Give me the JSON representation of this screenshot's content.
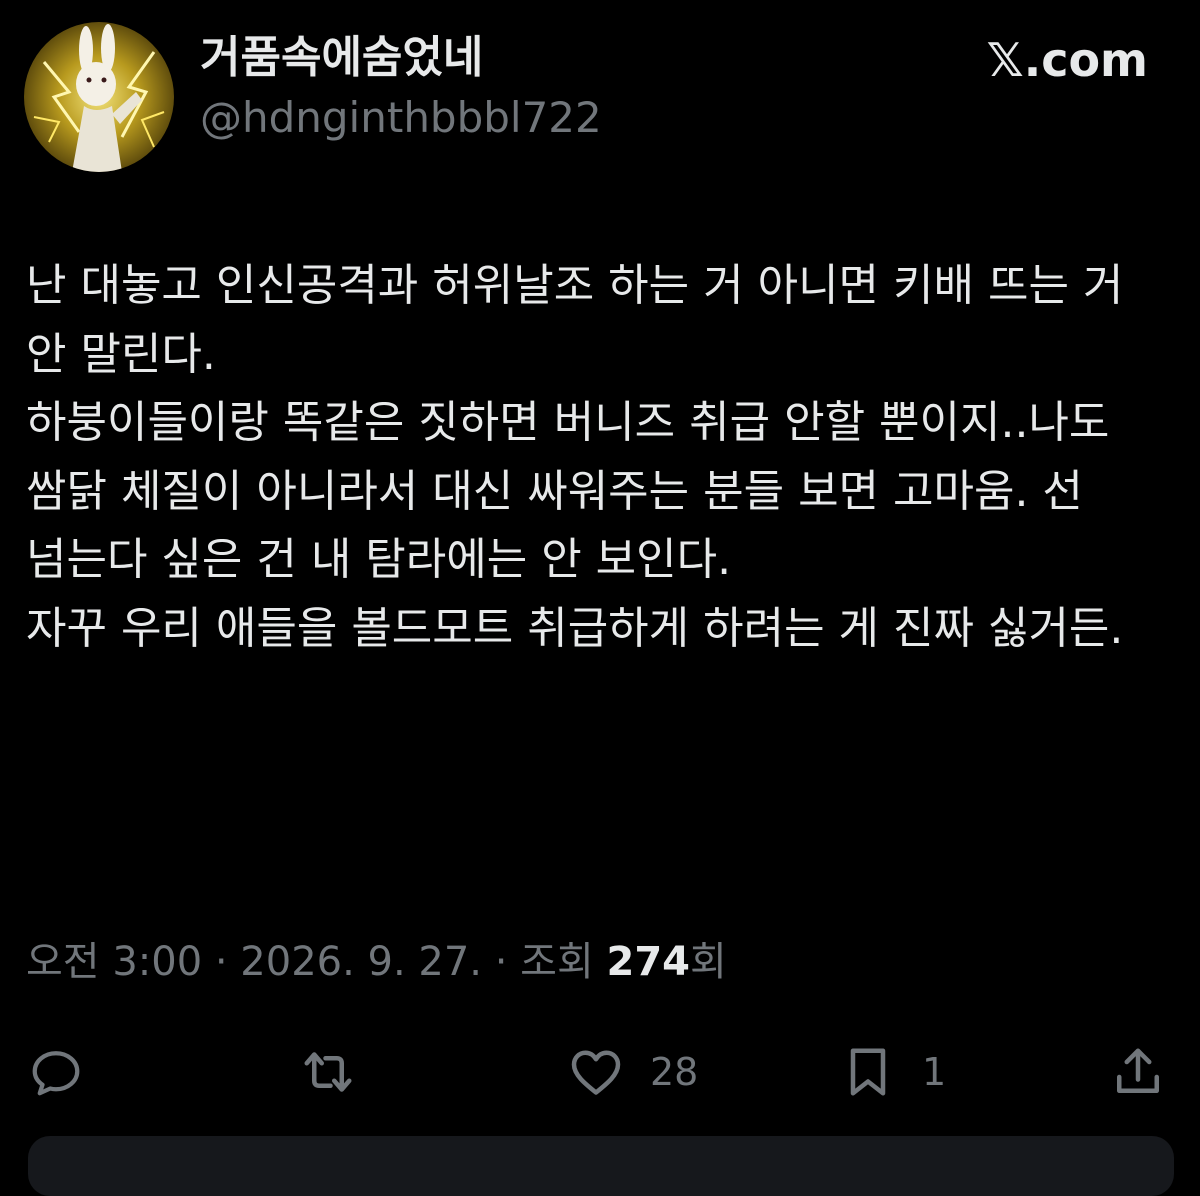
{
  "profile": {
    "display_name": "거품속에숨었네",
    "handle": "@hdnginthbbbl722",
    "avatar": "white-rabbit-lightning-avatar"
  },
  "brand": {
    "label": "𝕏.com"
  },
  "tweet": {
    "paragraphs": [
      "난 대놓고 인신공격과 허위날조 하는 거 아니면 키배 뜨는 거 안 말린다.",
      "하붕이들이랑 똑같은 짓하면 버니즈 취급 안할 뿐이지..나도 쌈닭 체질이 아니라서 대신 싸워주는 분들 보면 고마움. 선 넘는다 싶은 건 내 탐라에는 안 보인다.",
      "자꾸 우리 애들을 볼드모트 취급하게 하려는 게 진짜 싫거든."
    ]
  },
  "meta": {
    "time": "오전 3:00",
    "separator": " · ",
    "date": "2026. 9. 27.",
    "views_prefix": "조회 ",
    "views_count": "274",
    "views_suffix": "회"
  },
  "actions": {
    "reply": {
      "icon": "reply-icon"
    },
    "retweet": {
      "icon": "retweet-icon"
    },
    "like": {
      "icon": "heart-icon",
      "count": "28"
    },
    "bookmark": {
      "icon": "bookmark-icon",
      "count": "1"
    },
    "share": {
      "icon": "share-icon"
    }
  },
  "colors": {
    "background": "#000000",
    "text_primary": "#e7e9ea",
    "text_secondary": "#71767b",
    "panel": "#16181c"
  }
}
